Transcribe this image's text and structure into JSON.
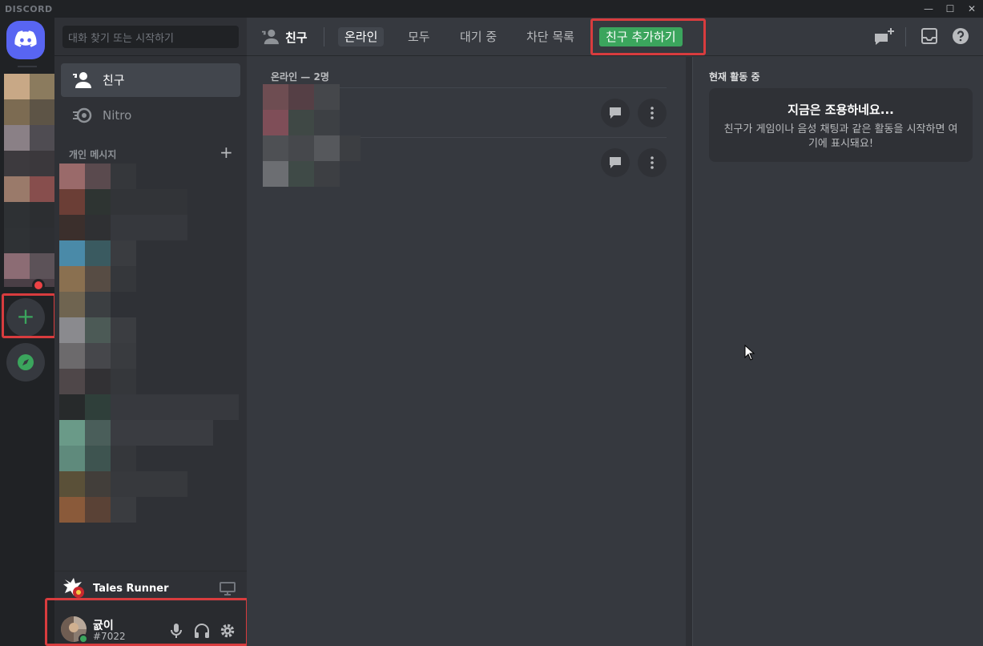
{
  "app": {
    "brand": "DISCORD",
    "min_glyph": "—",
    "max_glyph": "☐",
    "close_glyph": "✕"
  },
  "search": {
    "placeholder": "대화 찾기 또는 시작하기"
  },
  "sidebar": {
    "nav": [
      {
        "label": "친구",
        "icon": "friends-icon"
      },
      {
        "label": "Nitro",
        "icon": "nitro-icon"
      }
    ],
    "dm_header": "개인 메시지",
    "dm_add": "+"
  },
  "game": {
    "name": "Tales Runner"
  },
  "user": {
    "name": "귮이",
    "tag": "#7022",
    "status": "online",
    "status_color": "#3ba55d"
  },
  "header": {
    "title": "친구",
    "tabs": [
      {
        "label": "온라인",
        "active": true
      },
      {
        "label": "모두",
        "active": false
      },
      {
        "label": "대기 중",
        "active": false
      },
      {
        "label": "차단 목록",
        "active": false
      }
    ],
    "add_friend": "친구 추가하기"
  },
  "friends": {
    "section_label": "온라인 — 2명",
    "count": 2
  },
  "activity": {
    "title": "현재 활동 중",
    "empty_title": "지금은 조용하네요...",
    "empty_body": "친구가 게임이나 음성 채팅과 같은 활동을 시작하면 여기에 표시돼요!"
  },
  "colors": {
    "accent": "#5865f2",
    "green": "#3ba55d",
    "highlight": "#d83c3e"
  }
}
